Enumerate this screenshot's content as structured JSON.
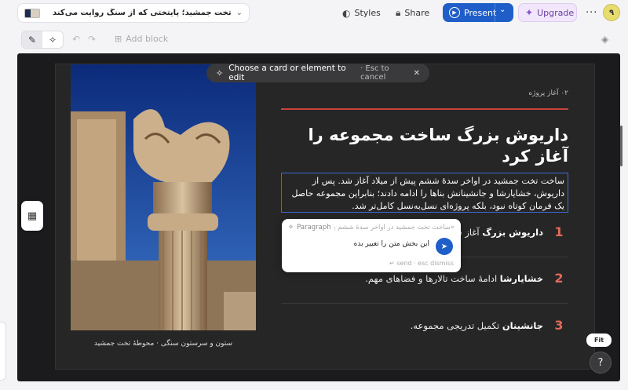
{
  "header": {
    "doc_title": "تخت جمشید؛ پایتختی که از سنگ روایت می‌کند",
    "styles_label": "Styles",
    "share_label": "Share",
    "present_label": "Present",
    "upgrade_label": "Upgrade",
    "avatar_initial": "۹",
    "more_label": "···"
  },
  "toolbar": {
    "add_block_label": "Add block"
  },
  "banner": {
    "text": "Choose a card or element to edit",
    "sub": "· Esc to cancel"
  },
  "slide": {
    "eyebrow": "۰۲ آغاز پروژه",
    "heading": "داریوش بزرگ ساخت مجموعه را آغاز کرد",
    "paragraph": "ساخت تخت جمشید در اواخر سدهٔ ششم پیش از میلاد آغاز شد. پس از داریوش، خشایارشا و جانشینانش بناها را ادامه دادند؛ بنابراین مجموعه حاصل یک فرمان کوتاه نبود، بلکه پروژه‌ای نسل‌به‌نسل کامل‌تر شد.",
    "caption": "ستون و سرستون سنگی · محوطهٔ تخت جمشید",
    "items": [
      {
        "num": "1",
        "bold": "داریوش بزرگ",
        "rest": " آغاز ساخت"
      },
      {
        "num": "2",
        "bold": "خشایارشا",
        "rest": " ادامهٔ ساخت تالارها و فضاهای مهم."
      },
      {
        "num": "3",
        "bold": "جانشینان",
        "rest": " تکمیل تدریجی مجموعه."
      }
    ]
  },
  "ai_popover": {
    "label": "Paragraph",
    "context": "«ساخت تخت جمشید در اواخر سدهٔ ششم پیش از م",
    "input_value": "این بخش متن را تغییر بده",
    "hint": "↵ send · esc dismiss"
  },
  "controls": {
    "fit_label": "Fit",
    "help_label": "?"
  }
}
